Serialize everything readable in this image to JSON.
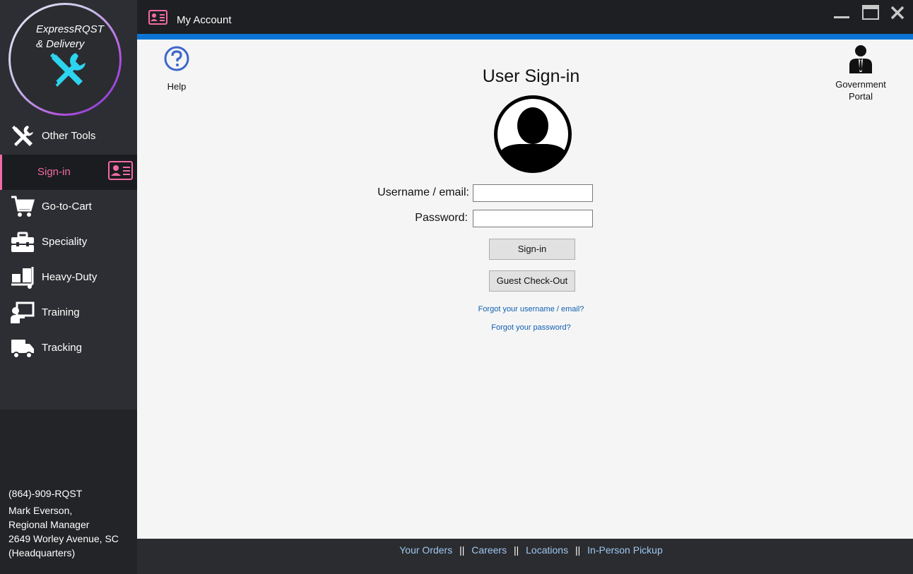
{
  "logo": {
    "line1": "ExpressRQST",
    "line2": "& Delivery"
  },
  "sidebar": {
    "items": [
      {
        "label": "Other Tools",
        "icon": "tools-icon"
      },
      {
        "label": "Sign-in",
        "icon": "id-card-icon",
        "active": true
      },
      {
        "label": "Go-to-Cart",
        "icon": "cart-icon"
      },
      {
        "label": "Speciality",
        "icon": "toolbox-icon"
      },
      {
        "label": "Heavy-Duty",
        "icon": "dolly-icon"
      },
      {
        "label": "Training",
        "icon": "presenter-icon"
      },
      {
        "label": "Tracking",
        "icon": "truck-icon"
      }
    ],
    "contact": {
      "phone": "(864)-909-RQST",
      "name": "Mark Everson,",
      "role": "Regional Manager",
      "address": "2649  Worley Avenue, SC",
      "note": "(Headquarters)"
    }
  },
  "header": {
    "title": "My Account"
  },
  "main": {
    "help_label": "Help",
    "gov_label_1": "Government",
    "gov_label_2": "Portal",
    "title": "User Sign-in",
    "username_label": "Username / email:",
    "password_label": "Password:",
    "username_value": "",
    "password_value": "",
    "signin_button": "Sign-in",
    "guest_button": "Guest Check-Out",
    "forgot_username": "Forgot your username / email?",
    "forgot_password": "Forgot your password?"
  },
  "footer": {
    "links": [
      "Your Orders",
      "Careers",
      "Locations",
      "In-Person Pickup"
    ],
    "separator": "||"
  },
  "colors": {
    "accent_blue": "#0a74d4",
    "active_pink": "#f06ba5",
    "logo_cyan": "#2dd4ef",
    "sidebar_bg": "#2d2e33",
    "footer_link": "#9ec9f0"
  }
}
